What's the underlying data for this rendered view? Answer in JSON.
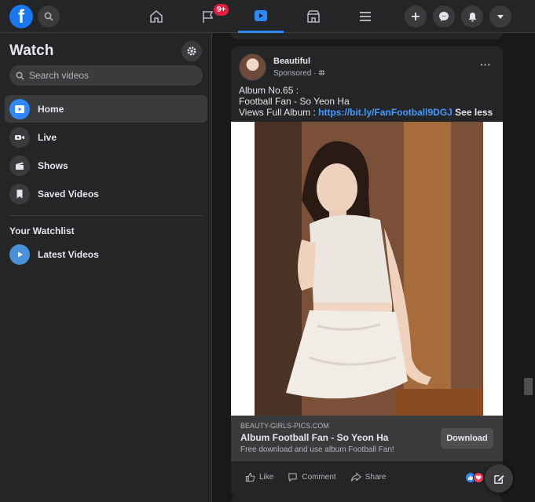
{
  "topbar": {
    "logo": "f",
    "notification_badge": "9+",
    "icons": [
      "search-icon",
      "home-icon",
      "flag-icon",
      "watch-icon",
      "marketplace-icon",
      "menu-icon",
      "plus-icon",
      "messenger-icon",
      "bell-icon",
      "caret-down-icon"
    ]
  },
  "sidebar": {
    "title": "Watch",
    "search_placeholder": "Search videos",
    "items": [
      {
        "label": "Home",
        "icon": "play-icon",
        "active": true
      },
      {
        "label": "Live",
        "icon": "live-camera-icon"
      },
      {
        "label": "Shows",
        "icon": "clapper-icon"
      },
      {
        "label": "Saved Videos",
        "icon": "bookmark-icon"
      }
    ],
    "watchlist_heading": "Your Watchlist",
    "watchlist": [
      {
        "label": "Latest Videos",
        "icon": "play-circle-icon"
      }
    ]
  },
  "post": {
    "page_name": "Beautiful",
    "sponsored": "Sponsored ·",
    "text_line1": "Album No.65 :",
    "text_line2": "Football Fan - So Yeon Ha",
    "text_line3_prefix": "Views Full Album : ",
    "link": "https://bit.ly/FanFootball9DGJ",
    "see_less": "See less",
    "ad": {
      "domain": "BEAUTY-GIRLS-PICS.COM",
      "title": "Album Football Fan - So Yeon Ha",
      "description": "Free download and use album Football Fan!",
      "cta": "Download"
    },
    "actions": {
      "like": "Like",
      "comment": "Comment",
      "share": "Share"
    }
  },
  "colors": {
    "accent": "#2d88ff",
    "background": "#18191a",
    "surface": "#242526",
    "link": "#4599ff",
    "badge": "#e41e3f"
  }
}
